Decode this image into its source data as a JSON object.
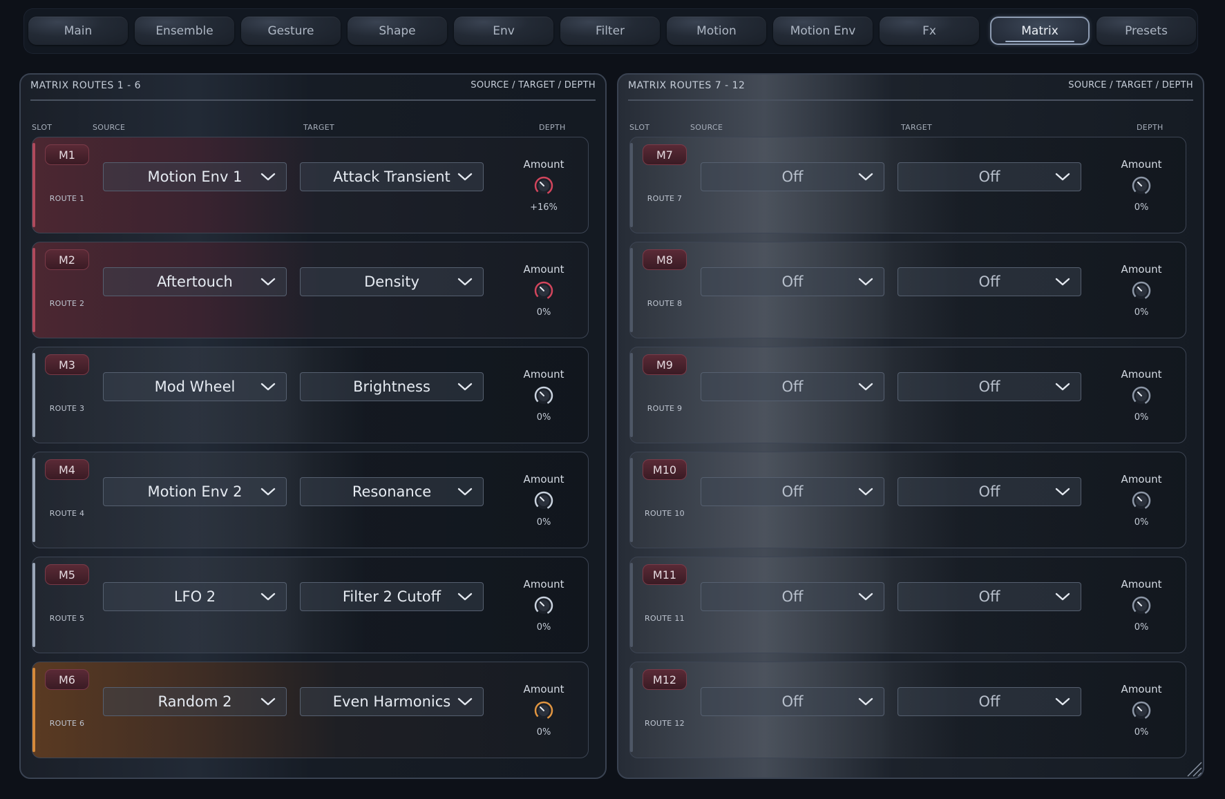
{
  "tabs": [
    {
      "label": "Main",
      "active": false
    },
    {
      "label": "Ensemble",
      "active": false
    },
    {
      "label": "Gesture",
      "active": false
    },
    {
      "label": "Shape",
      "active": false
    },
    {
      "label": "Env",
      "active": false
    },
    {
      "label": "Filter",
      "active": false
    },
    {
      "label": "Motion",
      "active": false
    },
    {
      "label": "Motion Env",
      "active": false
    },
    {
      "label": "Fx",
      "active": false
    },
    {
      "label": "Matrix",
      "active": true
    },
    {
      "label": "Presets",
      "active": false
    }
  ],
  "panels": [
    {
      "title": "MATRIX ROUTES 1 - 6",
      "subtitle": "SOURCE / TARGET / DEPTH",
      "col_slot": "SLOT",
      "col_source": "SOURCE",
      "col_target": "TARGET",
      "col_depth": "DEPTH",
      "routes": [
        {
          "slot": "M1",
          "route": "ROUTE 1",
          "source": "Motion Env 1",
          "target": "Attack Transient",
          "amount_label": "Amount",
          "amount": "+16%",
          "style": "red",
          "knob_color": "#d2455c"
        },
        {
          "slot": "M2",
          "route": "ROUTE 2",
          "source": "Aftertouch",
          "target": "Density",
          "amount_label": "Amount",
          "amount": "0%",
          "style": "red",
          "knob_color": "#d2455c"
        },
        {
          "slot": "M3",
          "route": "ROUTE 3",
          "source": "Mod Wheel",
          "target": "Brightness",
          "amount_label": "Amount",
          "amount": "0%",
          "style": "grey",
          "knob_color": "#c9d2de"
        },
        {
          "slot": "M4",
          "route": "ROUTE 4",
          "source": "Motion Env 2",
          "target": "Resonance",
          "amount_label": "Amount",
          "amount": "0%",
          "style": "grey",
          "knob_color": "#c9d2de"
        },
        {
          "slot": "M5",
          "route": "ROUTE 5",
          "source": "LFO 2",
          "target": "Filter 2 Cutoff",
          "amount_label": "Amount",
          "amount": "0%",
          "style": "grey",
          "knob_color": "#c9d2de"
        },
        {
          "slot": "M6",
          "route": "ROUTE 6",
          "source": "Random 2",
          "target": "Even Harmonics",
          "amount_label": "Amount",
          "amount": "0%",
          "style": "orange",
          "knob_color": "#e19540"
        }
      ]
    },
    {
      "title": "MATRIX ROUTES 7 - 12",
      "subtitle": "SOURCE / TARGET / DEPTH",
      "col_slot": "SLOT",
      "col_source": "SOURCE",
      "col_target": "TARGET",
      "col_depth": "DEPTH",
      "routes": [
        {
          "slot": "M7",
          "route": "ROUTE 7",
          "source": "Off",
          "target": "Off",
          "amount_label": "Amount",
          "amount": "0%",
          "style": "dim",
          "knob_color": "#8c96a6"
        },
        {
          "slot": "M8",
          "route": "ROUTE 8",
          "source": "Off",
          "target": "Off",
          "amount_label": "Amount",
          "amount": "0%",
          "style": "dim",
          "knob_color": "#8c96a6"
        },
        {
          "slot": "M9",
          "route": "ROUTE 9",
          "source": "Off",
          "target": "Off",
          "amount_label": "Amount",
          "amount": "0%",
          "style": "dim",
          "knob_color": "#8c96a6"
        },
        {
          "slot": "M10",
          "route": "ROUTE 10",
          "source": "Off",
          "target": "Off",
          "amount_label": "Amount",
          "amount": "0%",
          "style": "dim",
          "knob_color": "#8c96a6"
        },
        {
          "slot": "M11",
          "route": "ROUTE 11",
          "source": "Off",
          "target": "Off",
          "amount_label": "Amount",
          "amount": "0%",
          "style": "dim",
          "knob_color": "#8c96a6"
        },
        {
          "slot": "M12",
          "route": "ROUTE 12",
          "source": "Off",
          "target": "Off",
          "amount_label": "Amount",
          "amount": "0%",
          "style": "dim",
          "knob_color": "#8c96a6"
        }
      ]
    }
  ],
  "icons": {
    "dropdown": "chevron-down-icon",
    "knob": "knob-icon",
    "resize": "resize-grip-icon"
  }
}
